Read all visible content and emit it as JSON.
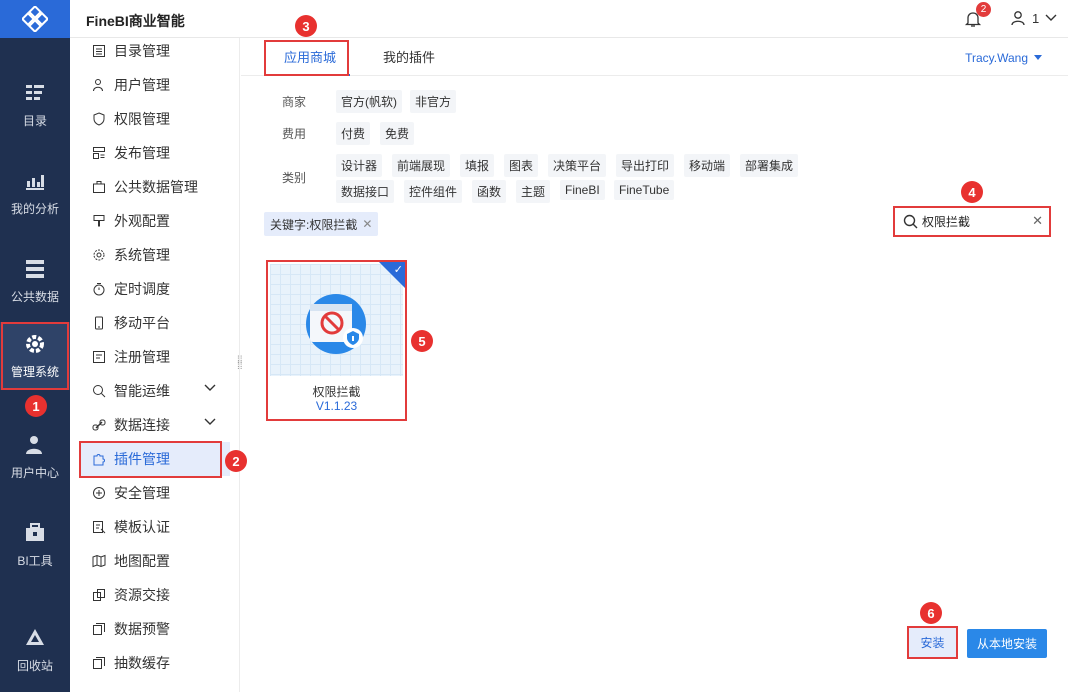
{
  "app_title": "FineBI商业智能",
  "header": {
    "notification_count": "2",
    "user_label": "1"
  },
  "rail": [
    {
      "label": "目录",
      "icon": "catalog-icon"
    },
    {
      "label": "我的分析",
      "icon": "analysis-icon"
    },
    {
      "label": "公共数据",
      "icon": "public-data-icon"
    },
    {
      "label": "管理系统",
      "icon": "gear-icon"
    },
    {
      "label": "用户中心",
      "icon": "user-center-icon"
    },
    {
      "label": "BI工具",
      "icon": "toolbox-icon"
    },
    {
      "label": "回收站",
      "icon": "recycle-icon"
    }
  ],
  "menu": [
    "目录管理",
    "用户管理",
    "权限管理",
    "发布管理",
    "公共数据管理",
    "外观配置",
    "系统管理",
    "定时调度",
    "移动平台",
    "注册管理",
    "智能运维",
    "数据连接",
    "插件管理",
    "安全管理",
    "模板认证",
    "地图配置",
    "资源交接",
    "数据预警",
    "抽数缓存"
  ],
  "tabs": {
    "store": "应用商城",
    "mine": "我的插件",
    "user": "Tracy.Wang"
  },
  "filters": {
    "vendor_label": "商家",
    "vendor": [
      "官方(帆软)",
      "非官方"
    ],
    "fee_label": "费用",
    "fee": [
      "付费",
      "免费"
    ],
    "category_label": "类别",
    "category_row1": [
      "设计器",
      "前端展现",
      "填报",
      "图表",
      "决策平台",
      "导出打印",
      "移动端",
      "部署集成"
    ],
    "category_row2": [
      "数据接口",
      "控件组件",
      "函数",
      "主题",
      "FineBI",
      "FineTube"
    ]
  },
  "keyword_tag": "关键字:权限拦截",
  "search": {
    "value": "权限拦截"
  },
  "plugin": {
    "name": "权限拦截",
    "version": "V1.1.23"
  },
  "buttons": {
    "install": "安装",
    "local_install": "从本地安装"
  },
  "annotations": [
    "1",
    "2",
    "3",
    "4",
    "5",
    "6"
  ]
}
